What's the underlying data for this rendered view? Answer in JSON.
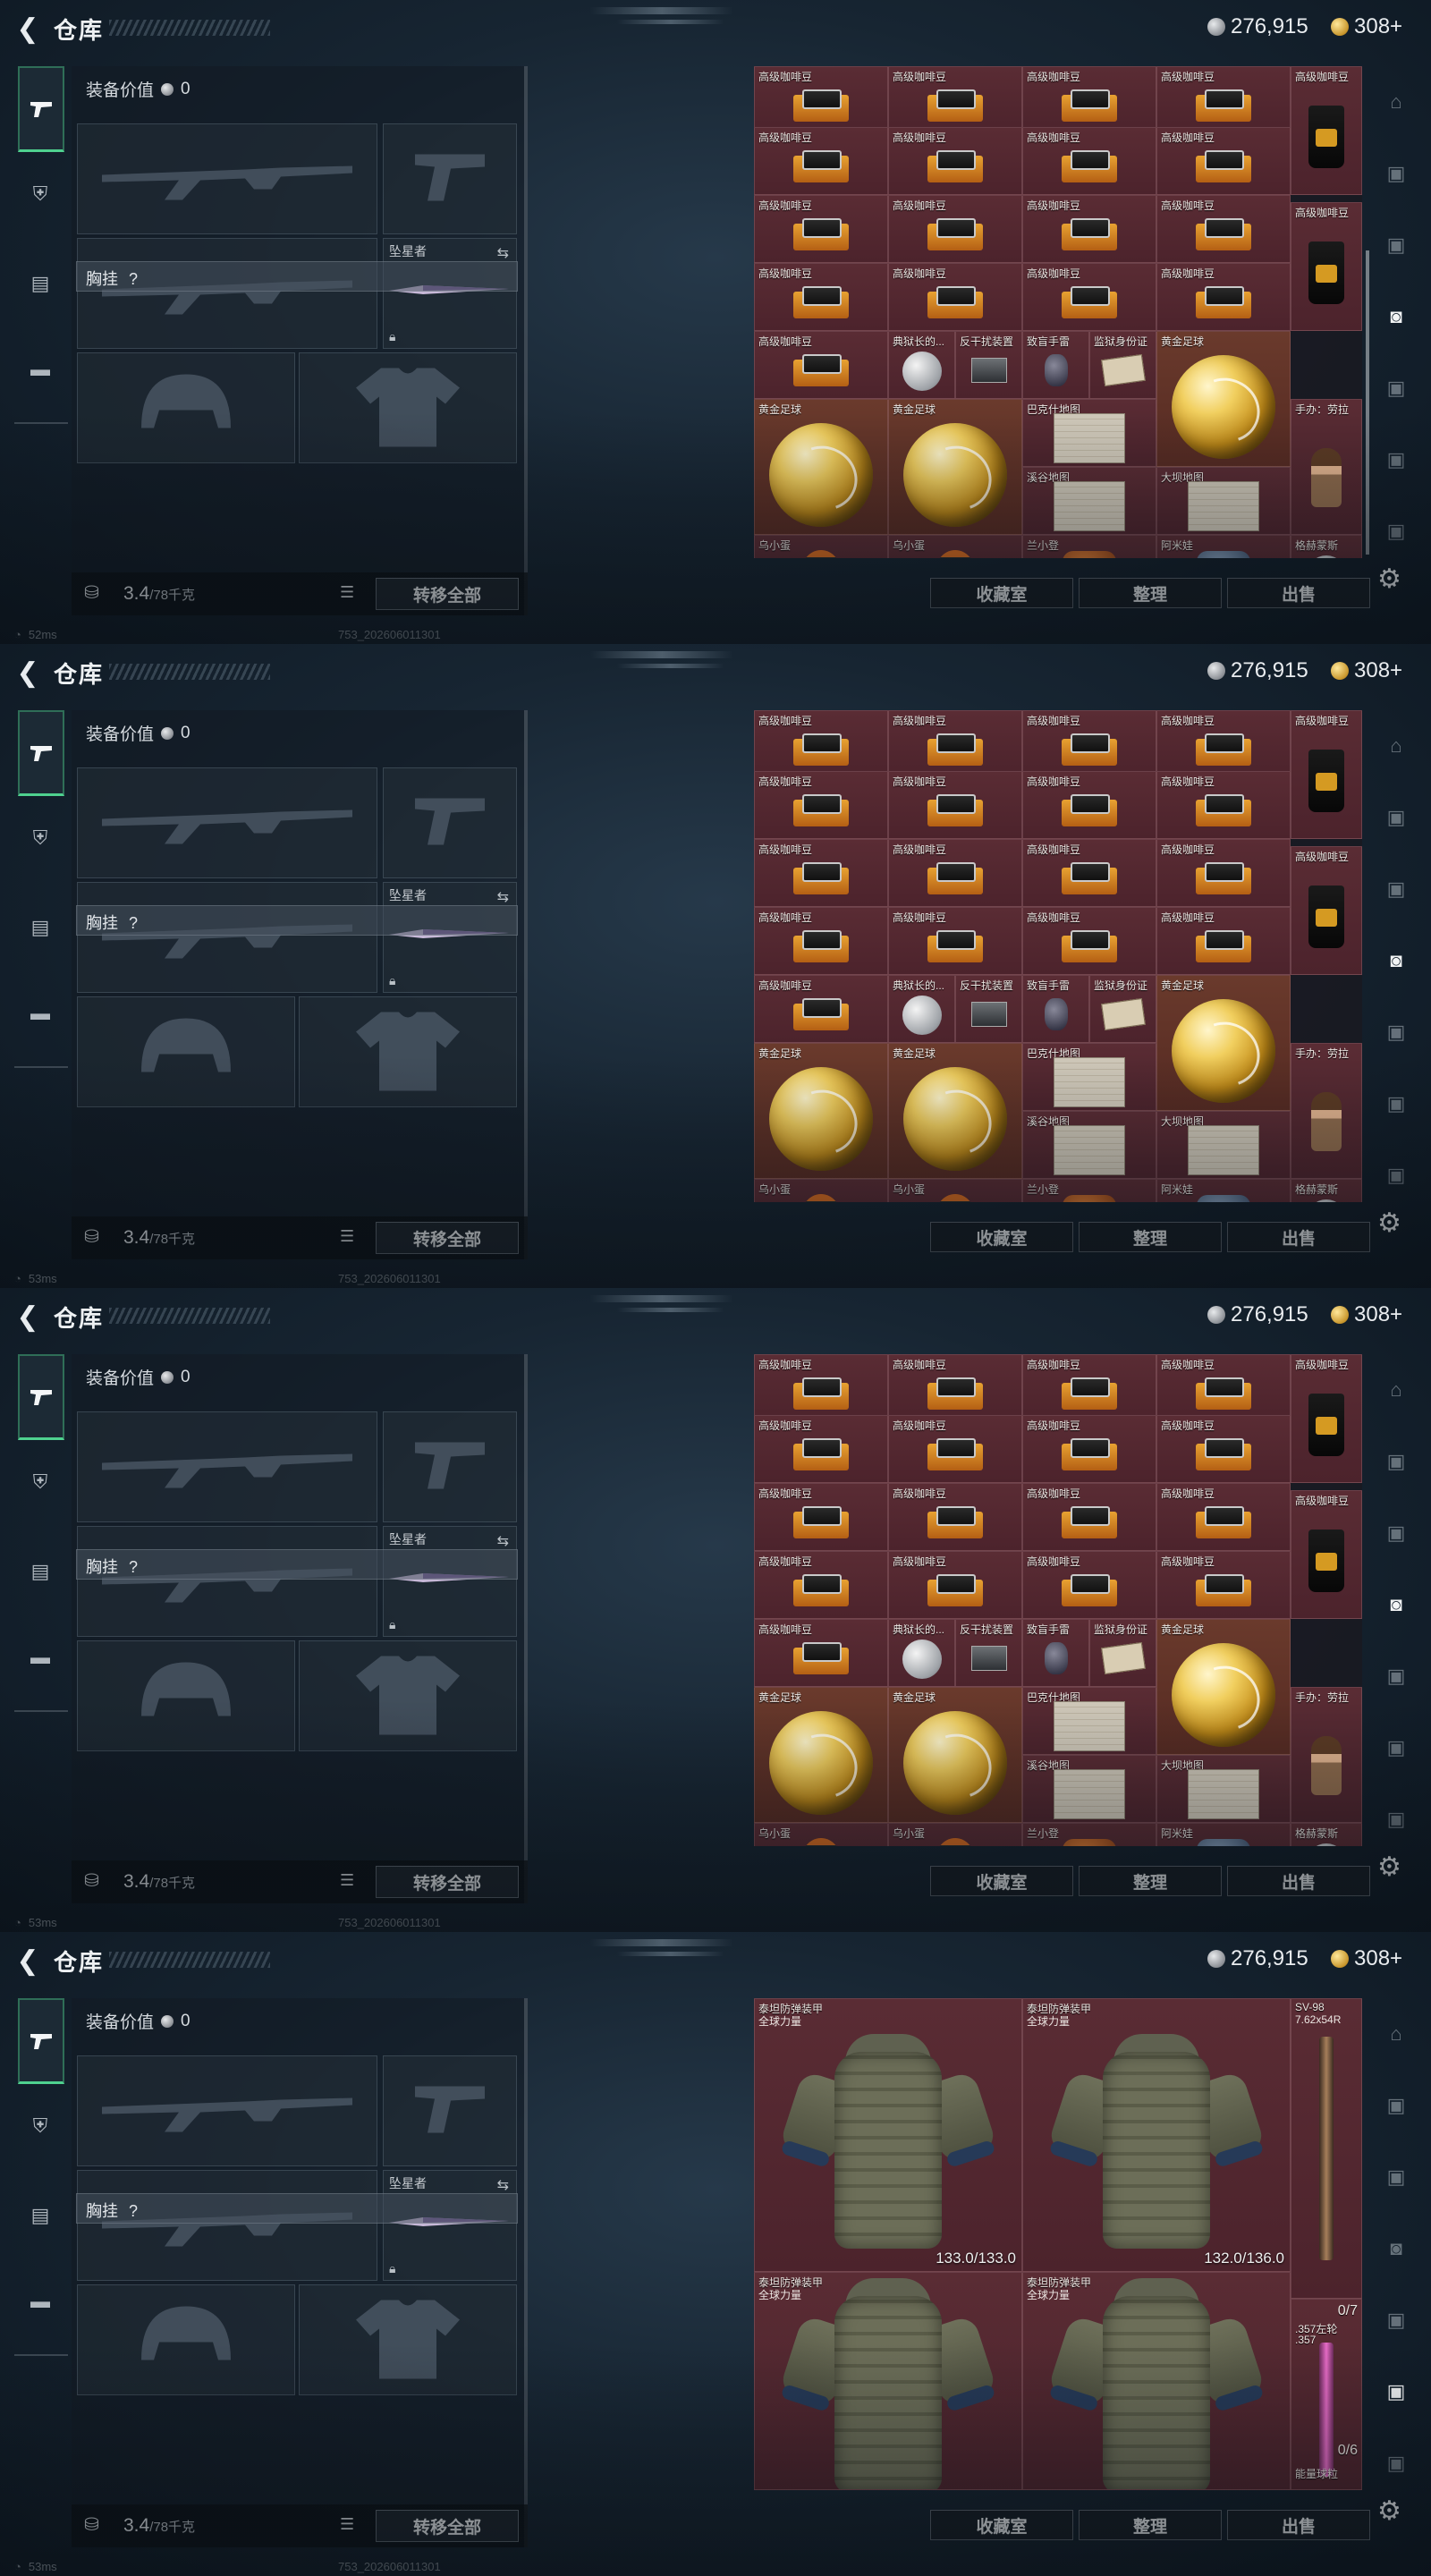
{
  "top": {
    "title": "仓库",
    "silver_amount": "276,915",
    "gold_amount": "308+",
    "silver_icon": "silver-coin-icon",
    "gold_icon": "gold-coin-icon"
  },
  "equipment": {
    "header": "装备价值",
    "value": "0",
    "melee_name": "坠星者",
    "vest_label": "胸挂",
    "vest_q": "?",
    "weight": "3.4",
    "weight_cap": "/78千克",
    "transfer_label": "转移全部"
  },
  "status": {
    "ping_1": "52ms",
    "ping_2": "53ms",
    "ping_3": "53ms",
    "ping_4": "53ms",
    "build": "753_202606011301"
  },
  "stash_buttons": {
    "collect": "收藏室",
    "sort": "整理",
    "sell": "出售"
  },
  "items": {
    "coffee": "高级咖啡豆",
    "yangyu": "典狱长的...",
    "anti": "反干扰装置",
    "zhimang": "致盲手雷",
    "jail_id": "监狱身份证",
    "gold_ball": "黄金足球",
    "baken": "巴克什地图",
    "xigu": "溪谷地图",
    "daba": "大坝地图",
    "figure": "手办：劳拉",
    "wuxiao": "乌小蛋",
    "lanxiao": "兰小登",
    "amiwa": "阿米娃",
    "gelin": "格赫蒙斯",
    "armor": "泰坦防弹装甲",
    "armor_sub": "全球力量",
    "armor_d1": "133.0/133.0",
    "armor_d2": "132.0/136.0",
    "sv98": "SV-98",
    "sv98_ammo": "7.62x54R",
    "rev_count": "0/7",
    "rev_ammo": ".357左轮",
    "rev_ammo2": ".357",
    "pink_count": "0/6",
    "pink_name": "能量球粒"
  },
  "colors": {
    "accent_green": "#4fd18f",
    "stash_red": "#5a2c34"
  }
}
